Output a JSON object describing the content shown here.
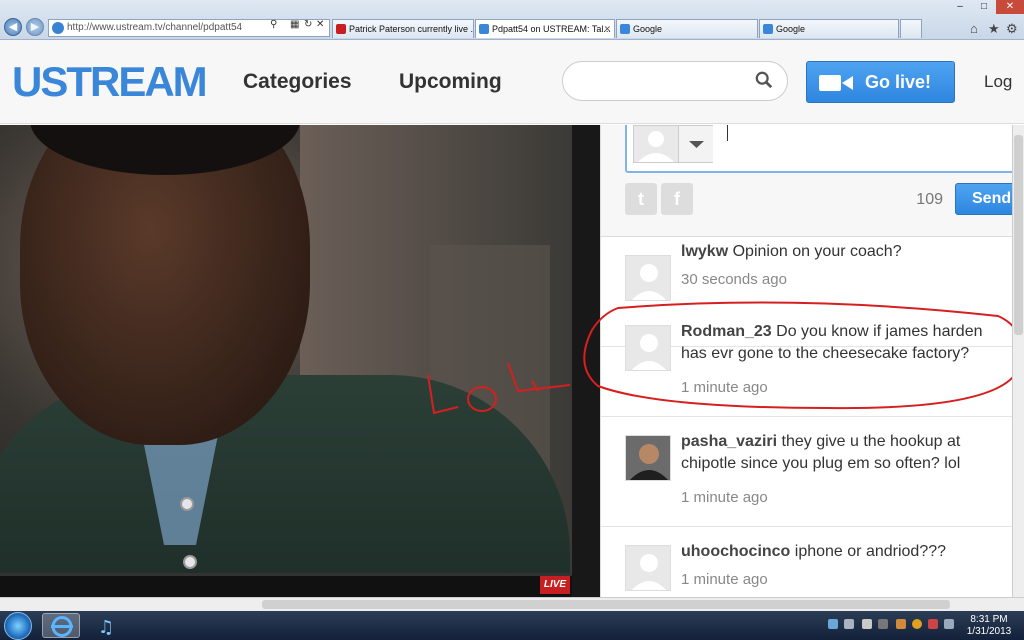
{
  "browser": {
    "address": "http://www.ustream.tv/channel/pdpatt54",
    "tabs": [
      {
        "title": "Patrick Paterson currently live ..."
      },
      {
        "title": "Pdpatt54 on USTREAM: Tal..."
      },
      {
        "title": "Google"
      },
      {
        "title": "Google"
      }
    ]
  },
  "header": {
    "logo": "USTREAM",
    "nav": [
      "Categories",
      "Upcoming"
    ],
    "search_placeholder": "",
    "golive_label": "Go live!",
    "login_label": "Log"
  },
  "video": {
    "live_badge": "LIVE",
    "annotation_text": "LOL"
  },
  "composer": {
    "char_count": "109",
    "send_label": "Send",
    "twitter": "t",
    "facebook": "f"
  },
  "messages": [
    {
      "user": "lwykw",
      "text": "Opinion on your coach?",
      "time": "30 seconds ago",
      "avatar": "default"
    },
    {
      "user": "Rodman_23",
      "text": "Do you know if james harden has evr gone to the cheesecake factory?",
      "time": "1 minute ago",
      "avatar": "default",
      "highlighted": true
    },
    {
      "user": "pasha_vaziri",
      "text": "they give u the hookup at chipotle since you plug em so often? lol",
      "time": "1 minute ago",
      "avatar": "photo"
    },
    {
      "user": "uhoochocinco",
      "text": "iphone or andriod???",
      "time": "1 minute ago",
      "avatar": "default"
    }
  ],
  "taskbar": {
    "time": "8:31 PM",
    "date": "1/31/2013"
  },
  "colors": {
    "brand": "#3a86d8",
    "button": "#2e86e0",
    "live": "#c71f1f",
    "annotation": "#d61f1f"
  }
}
